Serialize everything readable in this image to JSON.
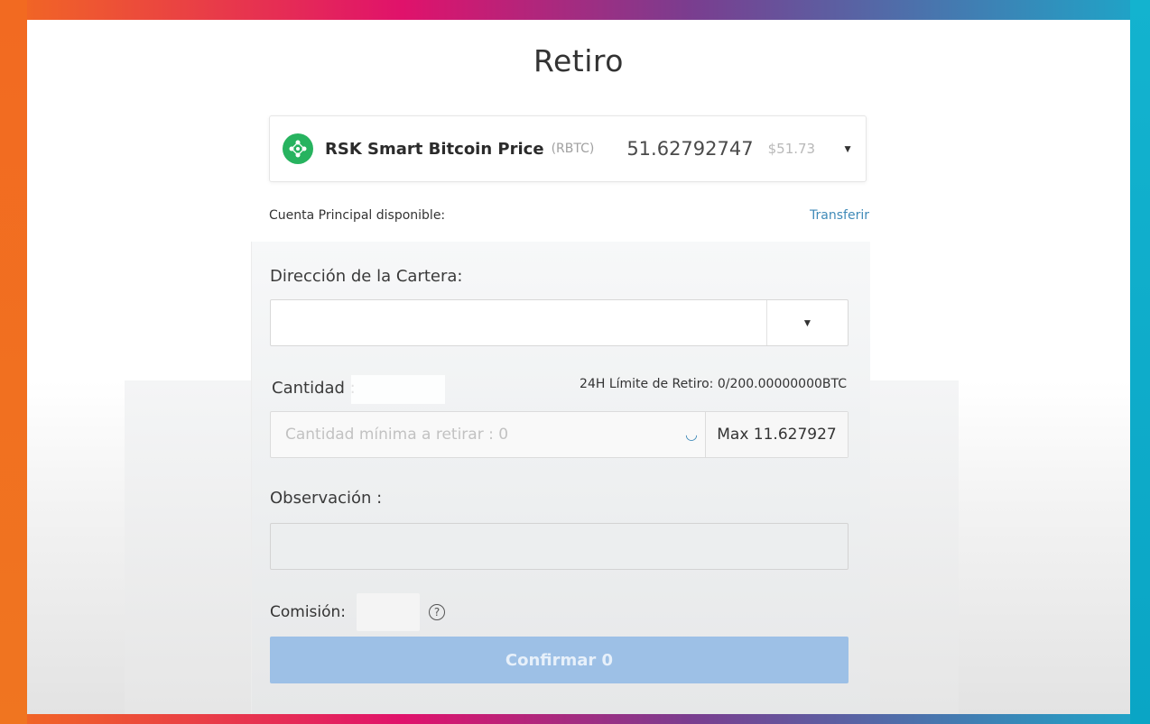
{
  "page": {
    "title": "Retiro"
  },
  "coin": {
    "name": "RSK Smart Bitcoin Price",
    "symbol": "(RBTC)",
    "balance": "51.62792747",
    "usd_value": "$51.73",
    "icon": "rsk-coin-icon",
    "icon_color": "#27b35f"
  },
  "account": {
    "available_label": "Cuenta Principal disponible:",
    "transfer_link": "Transferir"
  },
  "form": {
    "wallet_label": "Dirección de la Cartera:",
    "wallet_value": "",
    "amount_label": "Cantidad :",
    "limit_text": "24H Límite de Retiro: 0/200.00000000BTC",
    "amount_placeholder": "Cantidad mínima a retirar : 0",
    "max_label": "Max 11.627927",
    "note_label": "Observación :",
    "note_value": "",
    "fee_label": "Comisión:",
    "confirm_label": "Confirmar 0"
  },
  "colors": {
    "accent": "#3f8ab8",
    "confirm_bg": "#9dc0e6",
    "frame_left": "#f26a21",
    "frame_right": "#13b3cf"
  }
}
